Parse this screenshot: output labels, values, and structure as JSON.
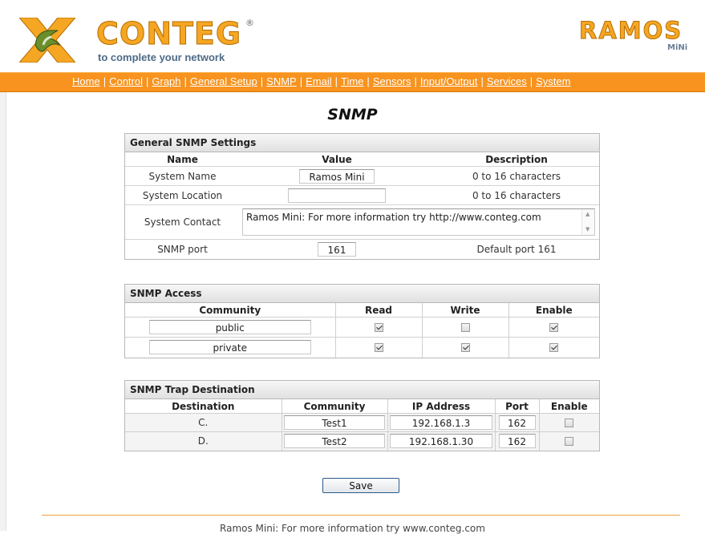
{
  "brand": {
    "company_logo_text": "CONTEG",
    "company_tagline": "to complete your network",
    "product_logo_text": "RAMOS",
    "product_logo_sub": "MiNi"
  },
  "nav": {
    "items": [
      "Home",
      "Control",
      "Graph",
      "General Setup",
      "SNMP",
      "Email",
      "Time",
      "Sensors",
      "Input/Output",
      "Services",
      "System"
    ]
  },
  "page_title": "SNMP",
  "general": {
    "title": "General SNMP Settings",
    "col_name": "Name",
    "col_value": "Value",
    "col_desc": "Description",
    "system_name_label": "System Name",
    "system_name_value": "Ramos Mini",
    "system_name_desc": "0 to 16 characters",
    "system_location_label": "System Location",
    "system_location_value": "",
    "system_location_desc": "0 to 16 characters",
    "system_contact_label": "System Contact",
    "system_contact_value": "Ramos Mini: For more information try http://www.conteg.com",
    "snmp_port_label": "SNMP port",
    "snmp_port_value": "161",
    "snmp_port_desc": "Default port 161"
  },
  "access": {
    "title": "SNMP Access",
    "col_community": "Community",
    "col_read": "Read",
    "col_write": "Write",
    "col_enable": "Enable",
    "rows": [
      {
        "community": "public",
        "read": true,
        "write": false,
        "enable": true
      },
      {
        "community": "private",
        "read": true,
        "write": true,
        "enable": true
      }
    ]
  },
  "trap": {
    "title": "SNMP Trap Destination",
    "col_destination": "Destination",
    "col_community": "Community",
    "col_ip": "IP Address",
    "col_port": "Port",
    "col_enable": "Enable",
    "rows": [
      {
        "destination": "C.",
        "community": "Test1",
        "ip": "192.168.1.3",
        "port": "162",
        "enable": false
      },
      {
        "destination": "D.",
        "community": "Test2",
        "ip": "192.168.1.30",
        "port": "162",
        "enable": false
      }
    ]
  },
  "save_label": "Save",
  "footer_text": "Ramos Mini: For more information try www.conteg.com",
  "colors": {
    "nav_bar": "#f7931e",
    "logo_orange": "#f5a623",
    "logo_green": "#6a8f2a"
  }
}
